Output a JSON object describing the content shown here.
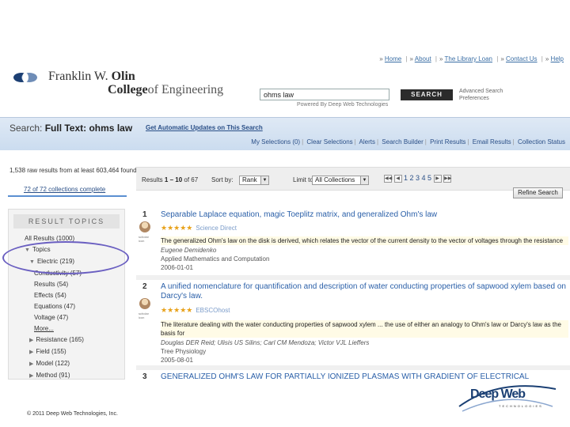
{
  "top_links": [
    "Home",
    "About",
    "The Library Loan",
    "Contact Us",
    "Help"
  ],
  "logo": {
    "line1_name": "Franklin W.",
    "line1_bold": "Olin",
    "line2_bold": "College",
    "line2_rest": "of Engineering"
  },
  "search": {
    "query": "ohms law",
    "button": "SEARCH",
    "powered_by": "Powered By Deep Web Technologies",
    "advanced": "Advanced Search",
    "preferences": "Preferences"
  },
  "search_bar": {
    "label": "Search:",
    "query_title": "Full Text: ohms law",
    "auto_updates": "Get Automatic Updates on This Search",
    "toolbar": [
      "My Selections (0)",
      "Clear Selections",
      "Alerts",
      "Search Builder",
      "Print Results",
      "Email Results",
      "Collection Status"
    ]
  },
  "results_found": "1,538 raw results from at least 603,464 found.",
  "collections_complete": "72 of 72 collections complete",
  "progress_fraction": 1.0,
  "topics": {
    "header": "RESULT TOPICS",
    "items": [
      {
        "label": "All Results (1000)",
        "indent": 0,
        "arrow": ""
      },
      {
        "label": "Topics",
        "indent": 0,
        "arrow": "▼"
      },
      {
        "label": "Electric (219)",
        "indent": 1,
        "arrow": "▼"
      },
      {
        "label": "Conductivity (57)",
        "indent": 2,
        "arrow": ""
      },
      {
        "label": "Results (54)",
        "indent": 2,
        "arrow": ""
      },
      {
        "label": "Effects (54)",
        "indent": 2,
        "arrow": ""
      },
      {
        "label": "Equations (47)",
        "indent": 2,
        "arrow": ""
      },
      {
        "label": "Voltage (47)",
        "indent": 2,
        "arrow": ""
      },
      {
        "label": "More...",
        "indent": 2,
        "arrow": ""
      },
      {
        "label": "Resistance (165)",
        "indent": 1,
        "arrow": "▶"
      },
      {
        "label": "Field (155)",
        "indent": 1,
        "arrow": "▶"
      },
      {
        "label": "Model (122)",
        "indent": 1,
        "arrow": "▶"
      },
      {
        "label": "Method (91)",
        "indent": 1,
        "arrow": "▶"
      }
    ]
  },
  "results_header": {
    "results_prefix": "Results",
    "results_range": "1 – 10",
    "results_suffix": "of 67",
    "sort_label": "Sort by:",
    "sort_value": "Rank",
    "limit_label": "Limit to:",
    "limit_value": "All Collections",
    "pages": "1 2 3 4 5",
    "refine_button": "Refine Search"
  },
  "results": [
    {
      "number": "1",
      "title": "Separable Laplace equation, magic Toeplitz matrix, and generalized Ohm's law",
      "stars": "★★★★★",
      "source": "Science Direct",
      "source_icon": "scholar icon",
      "snippet": "The generalized Ohm's law on the disk is derived, which relates the vector of the current density to the vector of voltages through the resistance",
      "author": "Eugene Demidenko",
      "journal": "Applied Mathematics and Computation",
      "date": "2006-01-01"
    },
    {
      "number": "2",
      "title": "A unified nomenclature for quantification and description of water conducting properties of sapwood xylem based on Darcy's law.",
      "stars": "★★★★★",
      "source": "EBSCOhost",
      "source_icon": "scholar icon",
      "snippet": "The literature dealing with the water conducting properties of sapwood xylem ... the use of either an analogy to Ohm's law or Darcy's law as the basis for",
      "author": "Douglas DER Reid; Ulisis US Silins; Carl CM Mendoza; Victor VJL Lieffers",
      "journal": "Tree Physiology",
      "date": "2005-08-01"
    },
    {
      "number": "3",
      "title": "GENERALIZED OHM'S LAW FOR PARTIALLY IONIZED PLASMAS WITH GRADIENT OF ELECTRICAL"
    }
  ],
  "footer": {
    "copyright": "© 2011 Deep Web Technologies, Inc.",
    "brand": "Deep Web",
    "brand_sub": "TECHNOLOGIES"
  }
}
